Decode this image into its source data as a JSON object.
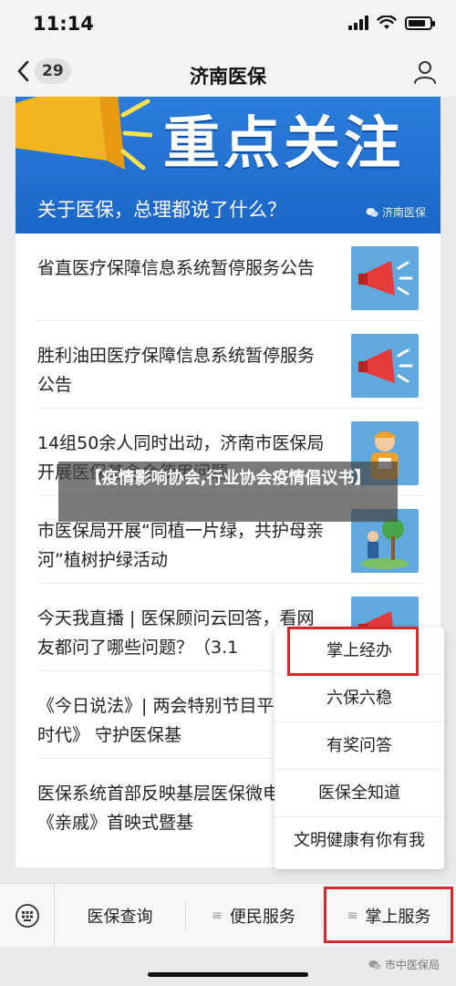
{
  "status": {
    "time": "11:14",
    "battery_level": 0.8
  },
  "nav": {
    "back_count": "29",
    "title": "济南医保"
  },
  "banner": {
    "headline": "重点关注",
    "subtitle": "关于医保，总理都说了什么？",
    "logo_text": "济南医保"
  },
  "articles": [
    {
      "title": "省直医疗保障信息系统暂停服务公告",
      "thumb": "megaphone"
    },
    {
      "title": "胜利油田医疗保障信息系统暂停服务公告",
      "thumb": "megaphone"
    },
    {
      "title": "14组50余人同时出动，济南市医保局开展医保基金会使用问题",
      "thumb": "worker"
    },
    {
      "title": "市医保局开展“同植一片绿，共护母亲河”植树护绿活动",
      "thumb": "tree"
    },
    {
      "title": "今天我直播 | 医保顾问云回答，看网友都问了哪些问题？（3.1",
      "thumb": "megaphone-small"
    },
    {
      "title": "《今日说法》| 两会特别节目平正义新时代》 守护医保基",
      "thumb": "none"
    },
    {
      "title": "医保系统首部反映基层医保微电影《亲戚》首映式暨基",
      "thumb": "none"
    }
  ],
  "popup_menu": [
    "掌上经办",
    "六保六稳",
    "有奖问答",
    "医保全知道",
    "文明健康有你有我"
  ],
  "tabs": {
    "tab1": "医保查询",
    "tab2": "便民服务",
    "tab3": "掌上服务",
    "menu_glyph": "≡"
  },
  "overlay_text": "【疫情影响协会,行业协会疫情倡议书】",
  "watermark": "市中医保局",
  "colors": {
    "highlight": "#d42a2a",
    "banner_blue": "#1f6fd0"
  }
}
